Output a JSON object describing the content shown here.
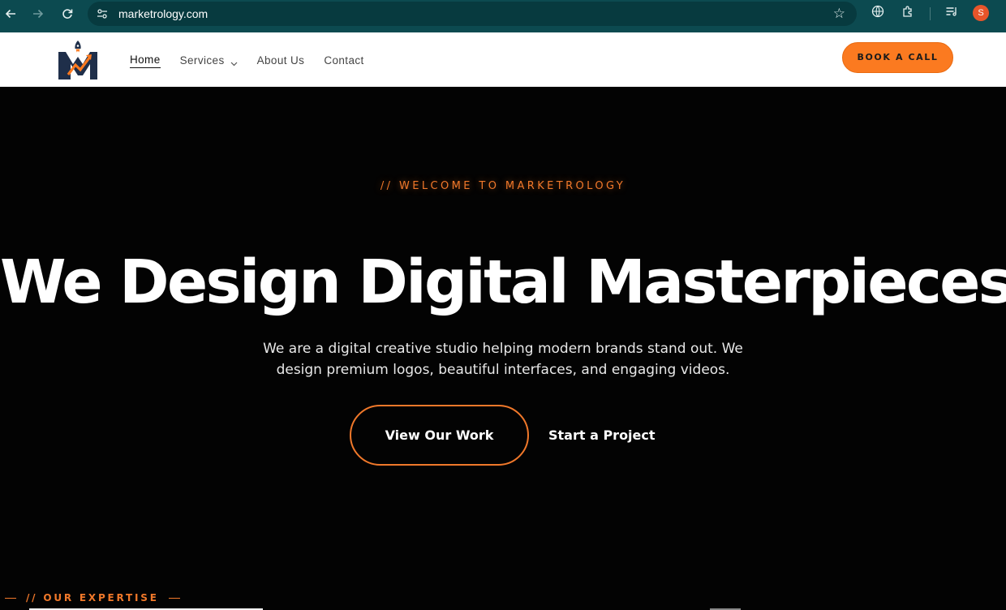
{
  "browser": {
    "url": "marketrology.com",
    "profile_initial": "S",
    "icons": [
      "back-icon",
      "forward-icon",
      "reload-icon",
      "site-info-icon",
      "bookmark-star-icon",
      "translate-icon",
      "extensions-icon",
      "reading-list-icon"
    ]
  },
  "header": {
    "nav": {
      "home": "Home",
      "services": "Services",
      "about": "About Us",
      "contact": "Contact"
    },
    "cta": "BOOK A CALL"
  },
  "hero": {
    "eyebrow": "// WELCOME TO MARKETROLOGY",
    "headline": "We Design Digital Masterpieces.",
    "subtext": "We are a digital creative studio helping modern brands stand out. We design premium logos, beautiful interfaces, and engaging videos.",
    "primary_button": "View Our Work",
    "secondary_button": "Start a Project"
  },
  "expertise": {
    "label": "// OUR EXPERTISE"
  },
  "colors": {
    "chrome": "#0c4a50",
    "accent": "#fb7a20",
    "background": "#030303",
    "logo_navy": "#1f2f4a"
  }
}
